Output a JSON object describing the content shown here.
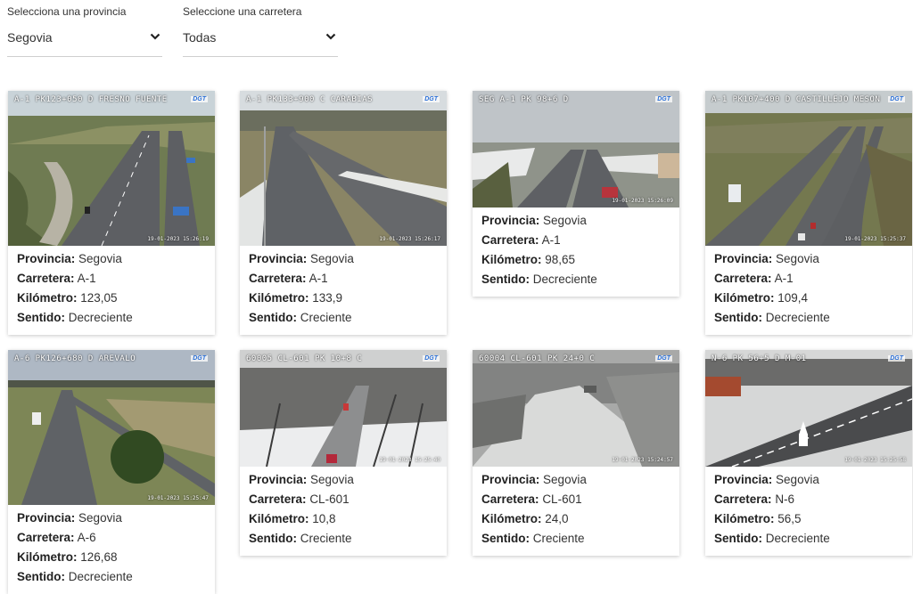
{
  "filters": {
    "province": {
      "label": "Selecciona una provincia",
      "value": "Segovia"
    },
    "road": {
      "label": "Seleccione una carretera",
      "value": "Todas"
    }
  },
  "field_labels": {
    "provincia": "Provincia:",
    "carretera": "Carretera:",
    "kilometro": "Kilómetro:",
    "sentido": "Sentido:"
  },
  "cameras": [
    {
      "overlay": "A-1 PK123+050 D FRESNO FUENTE",
      "logo": "DGT",
      "timestamp": "19-01-2023 15:26:19",
      "provincia": "Segovia",
      "carretera": "A-1",
      "kilometro": "123,05",
      "sentido": "Decreciente"
    },
    {
      "overlay": "A-1 PK133+900 C CARABIAS",
      "logo": "DGT",
      "timestamp": "19-01-2023 15:26:17",
      "provincia": "Segovia",
      "carretera": "A-1",
      "kilometro": "133,9",
      "sentido": "Creciente"
    },
    {
      "overlay": "SEG A-1 PK 98+6 D",
      "logo": "DGT",
      "timestamp": "19-01-2023 15:26:09",
      "provincia": "Segovia",
      "carretera": "A-1",
      "kilometro": "98,65",
      "sentido": "Decreciente"
    },
    {
      "overlay": "A-1 PK107+400 D CASTILLEJO MESON",
      "logo": "DGT",
      "timestamp": "19-01-2023 15:25:37",
      "provincia": "Segovia",
      "carretera": "A-1",
      "kilometro": "109,4",
      "sentido": "Decreciente"
    },
    {
      "overlay": "A-6 PK126+680 D AREVALO",
      "logo": "DGT",
      "timestamp": "19-01-2023 15:25:47",
      "provincia": "Segovia",
      "carretera": "A-6",
      "kilometro": "126,68",
      "sentido": "Decreciente"
    },
    {
      "overlay": "60005 CL-601 PK 10+8 C",
      "logo": "DGT",
      "timestamp": "19-01-2023 15:25:40",
      "provincia": "Segovia",
      "carretera": "CL-601",
      "kilometro": "10,8",
      "sentido": "Creciente"
    },
    {
      "overlay": "60004 CL-601 PK 24+0 C",
      "logo": "DGT",
      "timestamp": "19-01-2023 15:24:57",
      "provincia": "Segovia",
      "carretera": "CL-601",
      "kilometro": "24,0",
      "sentido": "Creciente"
    },
    {
      "overlay": "N-6 PK 56+5 D M-01",
      "logo": "DGT",
      "timestamp": "19-01-2023 15:25:58",
      "provincia": "Segovia",
      "carretera": "N-6",
      "kilometro": "56,5",
      "sentido": "Decreciente"
    }
  ]
}
